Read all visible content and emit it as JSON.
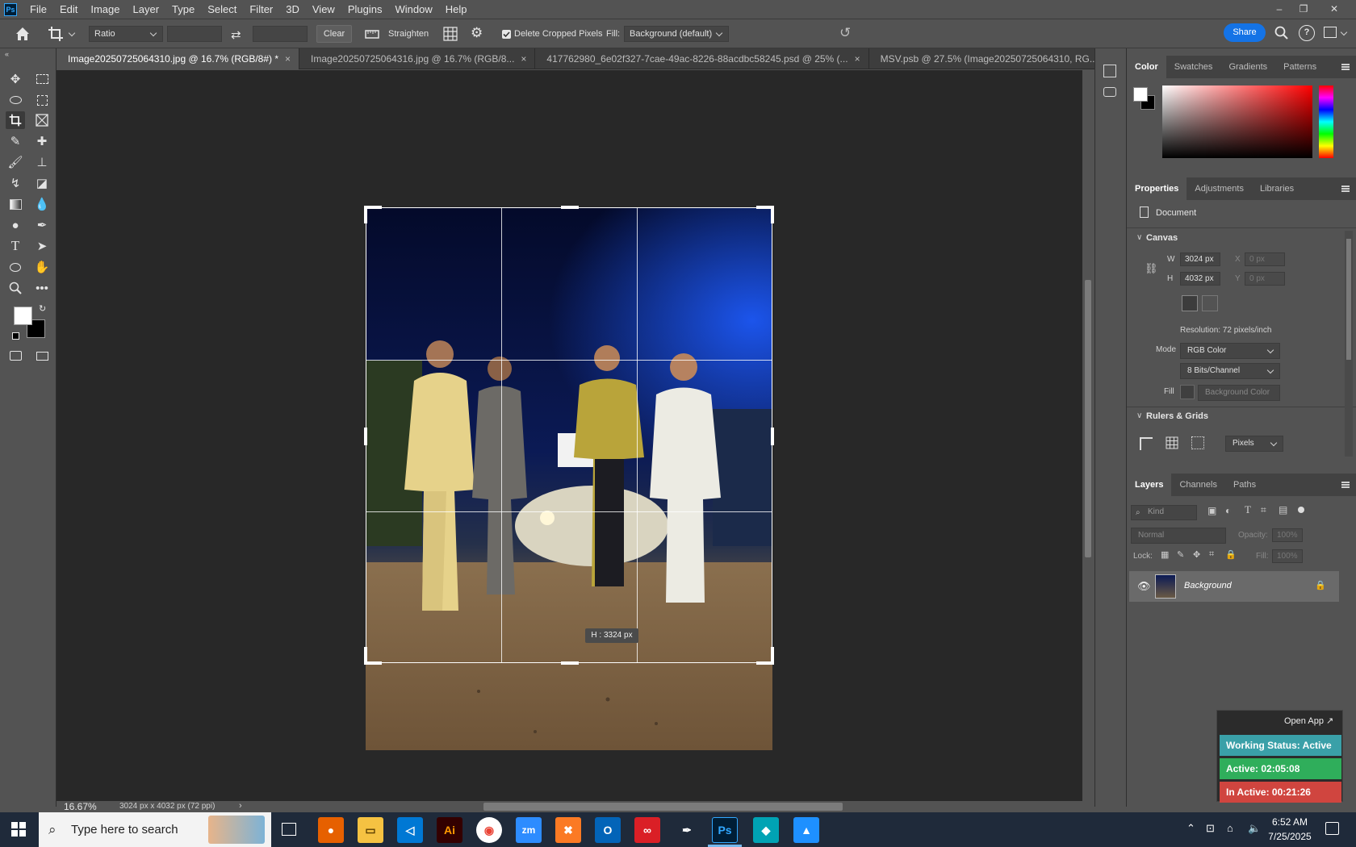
{
  "app": {
    "logo_text": "Ps"
  },
  "menu": [
    "File",
    "Edit",
    "Image",
    "Layer",
    "Type",
    "Select",
    "Filter",
    "3D",
    "View",
    "Plugins",
    "Window",
    "Help"
  ],
  "window_controls": {
    "minimize": "–",
    "restore": "❐",
    "close": "✕"
  },
  "options": {
    "ratio_label": "Ratio",
    "clear_label": "Clear",
    "straighten_label": "Straighten",
    "delete_cropped_label": "Delete Cropped Pixels",
    "delete_cropped_checked": true,
    "fill_label": "Fill:",
    "fill_value": "Background (default)",
    "share_label": "Share"
  },
  "tabs": [
    {
      "label": "Image20250725064310.jpg @ 16.7% (RGB/8#) *",
      "active": true
    },
    {
      "label": "Image20250725064316.jpg @ 16.7% (RGB/8...",
      "active": false
    },
    {
      "label": "417762980_6e02f327-7cae-49ac-8226-88acdbc58245.psd @ 25% (...",
      "active": false
    },
    {
      "label": "MSV.psb @ 27.5% (Image20250725064310, RG...",
      "active": false
    }
  ],
  "crop": {
    "dimension_label": "H :  3324 px"
  },
  "status": {
    "zoom": "16.67%",
    "doc_info": "3024 px x 4032 px (72 ppi)"
  },
  "color_panel": {
    "tabs": [
      "Color",
      "Swatches",
      "Gradients",
      "Patterns"
    ],
    "foreground": "#ffffff",
    "background": "#000000",
    "hue_color": "#ff0000"
  },
  "properties_panel": {
    "tabs": [
      "Properties",
      "Adjustments",
      "Libraries"
    ],
    "document_label": "Document",
    "canvas_heading": "Canvas",
    "w_label": "W",
    "w_value": "3024 px",
    "h_label": "H",
    "h_value": "4032 px",
    "x_label": "X",
    "x_value": "0 px",
    "y_label": "Y",
    "y_value": "0 px",
    "resolution": "Resolution: 72 pixels/inch",
    "mode_label": "Mode",
    "mode_value": "RGB Color",
    "bits_value": "8 Bits/Channel",
    "fill_label": "Fill",
    "fill_value": "Background Color",
    "rulers_heading": "Rulers & Grids",
    "units_value": "Pixels"
  },
  "layers_panel": {
    "tabs": [
      "Layers",
      "Channels",
      "Paths"
    ],
    "kind_placeholder": "Kind",
    "blend_mode": "Normal",
    "opacity_label": "Opacity:",
    "opacity_value": "100%",
    "lock_label": "Lock:",
    "fill_label": "Fill:",
    "fill_value": "100%",
    "layer_name": "Background"
  },
  "timer_widget": {
    "open_app": "Open App ↗",
    "working_status": "Working Status: Active",
    "active": "Active: 02:05:08",
    "inactive": "In Active: 00:21:26",
    "colors": {
      "status": "#3aa0a8",
      "active": "#2fae5b",
      "inactive": "#d0453f"
    }
  },
  "taskbar": {
    "search_placeholder": "Type here to search",
    "time": "6:52 AM",
    "date": "7/25/2025",
    "apps": [
      "firefox-icon",
      "file-explorer-icon",
      "vscode-icon",
      "illustrator-icon",
      "chrome-icon",
      "zoom-icon",
      "xampp-icon",
      "outlook-icon",
      "creative-cloud-icon",
      "pen-tool-icon",
      "photoshop-icon",
      "app-icon",
      "photos-icon"
    ]
  }
}
